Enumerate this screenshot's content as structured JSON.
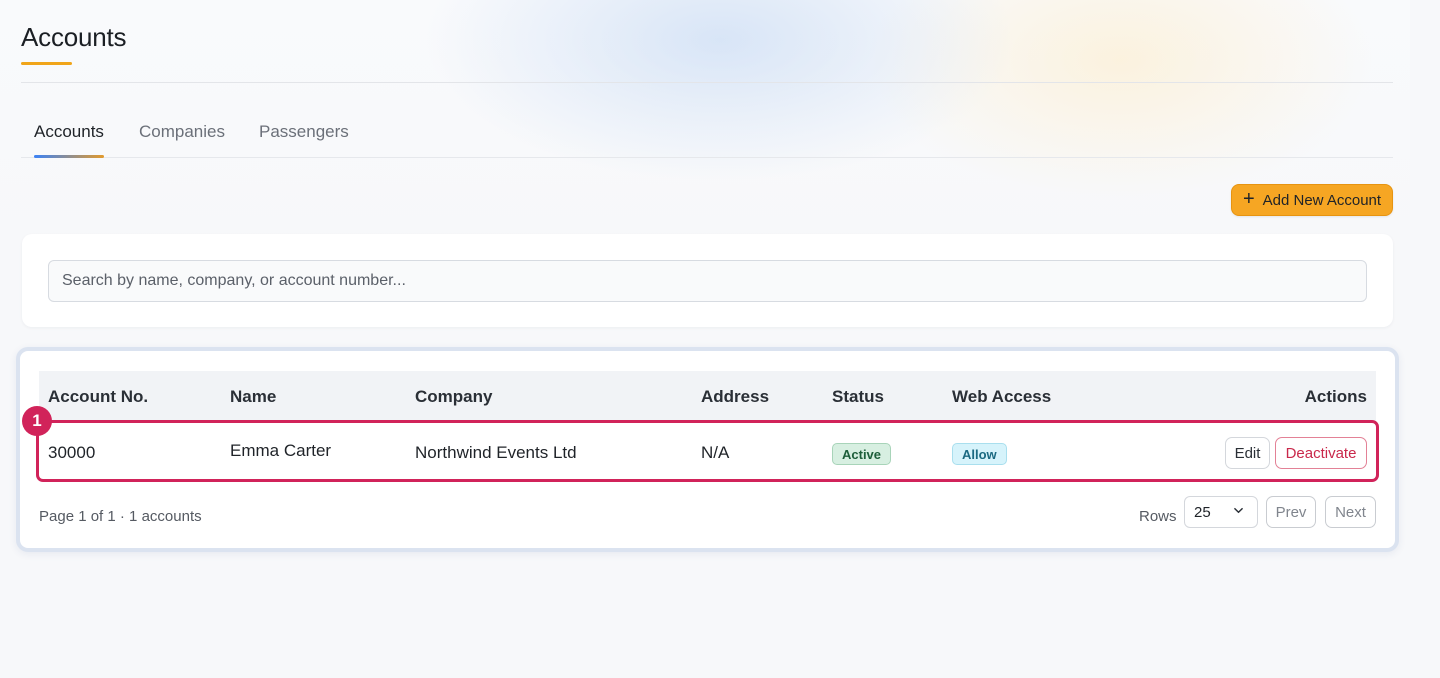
{
  "page": {
    "title": "Accounts"
  },
  "tabs": [
    {
      "label": "Accounts",
      "active": true
    },
    {
      "label": "Companies",
      "active": false
    },
    {
      "label": "Passengers",
      "active": false
    }
  ],
  "toolbar": {
    "add_label": "Add New Account",
    "add_icon": "plus-icon"
  },
  "search": {
    "placeholder": "Search by name, company, or account number...",
    "value": ""
  },
  "table": {
    "columns": [
      "Account No.",
      "Name",
      "Company",
      "Address",
      "Status",
      "Web Access",
      "Actions"
    ],
    "rows": [
      {
        "marker": "1",
        "account_no": "30000",
        "name": "Emma Carter",
        "company": "Northwind Events Ltd",
        "address": "N/A",
        "status": "Active",
        "web_access": "Allow",
        "edit_label": "Edit",
        "deactivate_label": "Deactivate"
      }
    ]
  },
  "pagination": {
    "summary": "Page 1 of 1 · 1 accounts",
    "rows_label": "Rows",
    "rows_value": "25",
    "prev_label": "Prev",
    "next_label": "Next"
  },
  "colors": {
    "accent": "#f6a623",
    "highlight": "#d1235a",
    "status_active": "#d7efe1",
    "web_allow": "#d6f3fb"
  }
}
